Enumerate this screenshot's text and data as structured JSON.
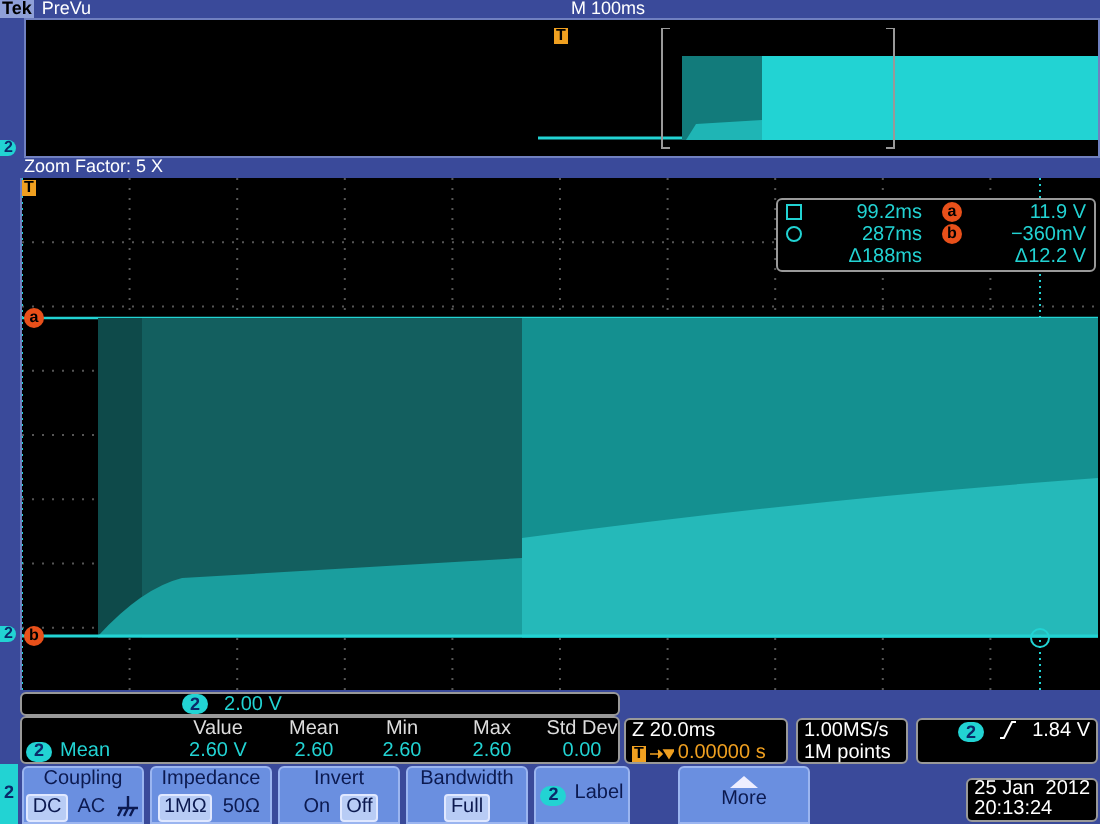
{
  "header": {
    "brand": "Tek",
    "mode": "PreVu",
    "timebase": "M 100ms"
  },
  "preview": {
    "channel": "2",
    "trigger": "T"
  },
  "zoom_bar": {
    "label": "Zoom Factor: 5 X"
  },
  "main": {
    "trigger": "T",
    "channel": "2",
    "cursor_a": "a",
    "cursor_b": "b"
  },
  "cursor_readout": [
    {
      "kind": "square",
      "time": "99.2ms",
      "cursor": "a",
      "volts": "11.9 V"
    },
    {
      "kind": "circle",
      "time": "287ms",
      "cursor": "b",
      "volts": "−360mV"
    },
    {
      "kind": "delta",
      "time": "Δ188ms",
      "volts": "Δ12.2 V"
    }
  ],
  "scale": {
    "channel": "2",
    "value": "2.00 V"
  },
  "measurement": {
    "channel": "2",
    "name": "Mean",
    "columns": [
      "Value",
      "Mean",
      "Min",
      "Max",
      "Std Dev"
    ],
    "values": [
      "2.60 V",
      "2.60",
      "2.60",
      "2.60",
      "0.00"
    ]
  },
  "horizontal": {
    "zoom": "Z 20.0ms",
    "trigger": "T",
    "position": "0.00000 s"
  },
  "acquisition": {
    "rate": "1.00MS/s",
    "length": "1M points"
  },
  "trigger_readout": {
    "channel": "2",
    "level": "1.84 V"
  },
  "menu": {
    "channel": "2",
    "items": [
      {
        "kind": "options",
        "title": "Coupling",
        "options": [
          {
            "kind": "text",
            "label": "DC",
            "selected": true
          },
          {
            "kind": "text",
            "label": "AC",
            "selected": false
          },
          {
            "kind": "ground",
            "selected": false
          }
        ]
      },
      {
        "kind": "options",
        "title": "Impedance",
        "options": [
          {
            "kind": "text",
            "label": "1MΩ",
            "selected": true
          },
          {
            "kind": "text",
            "label": "50Ω",
            "selected": false
          }
        ]
      },
      {
        "kind": "options",
        "title": "Invert",
        "options": [
          {
            "kind": "text",
            "label": "On",
            "selected": false
          },
          {
            "kind": "text",
            "label": "Off",
            "selected": true
          }
        ]
      },
      {
        "kind": "value",
        "title": "Bandwidth",
        "value": "Full"
      },
      {
        "kind": "label",
        "channel": "2",
        "title": "Label"
      },
      {
        "kind": "blank"
      },
      {
        "kind": "more",
        "title": "More"
      }
    ]
  },
  "datetime": {
    "date": "25 Jan  2012",
    "time": "20:13:24"
  }
}
